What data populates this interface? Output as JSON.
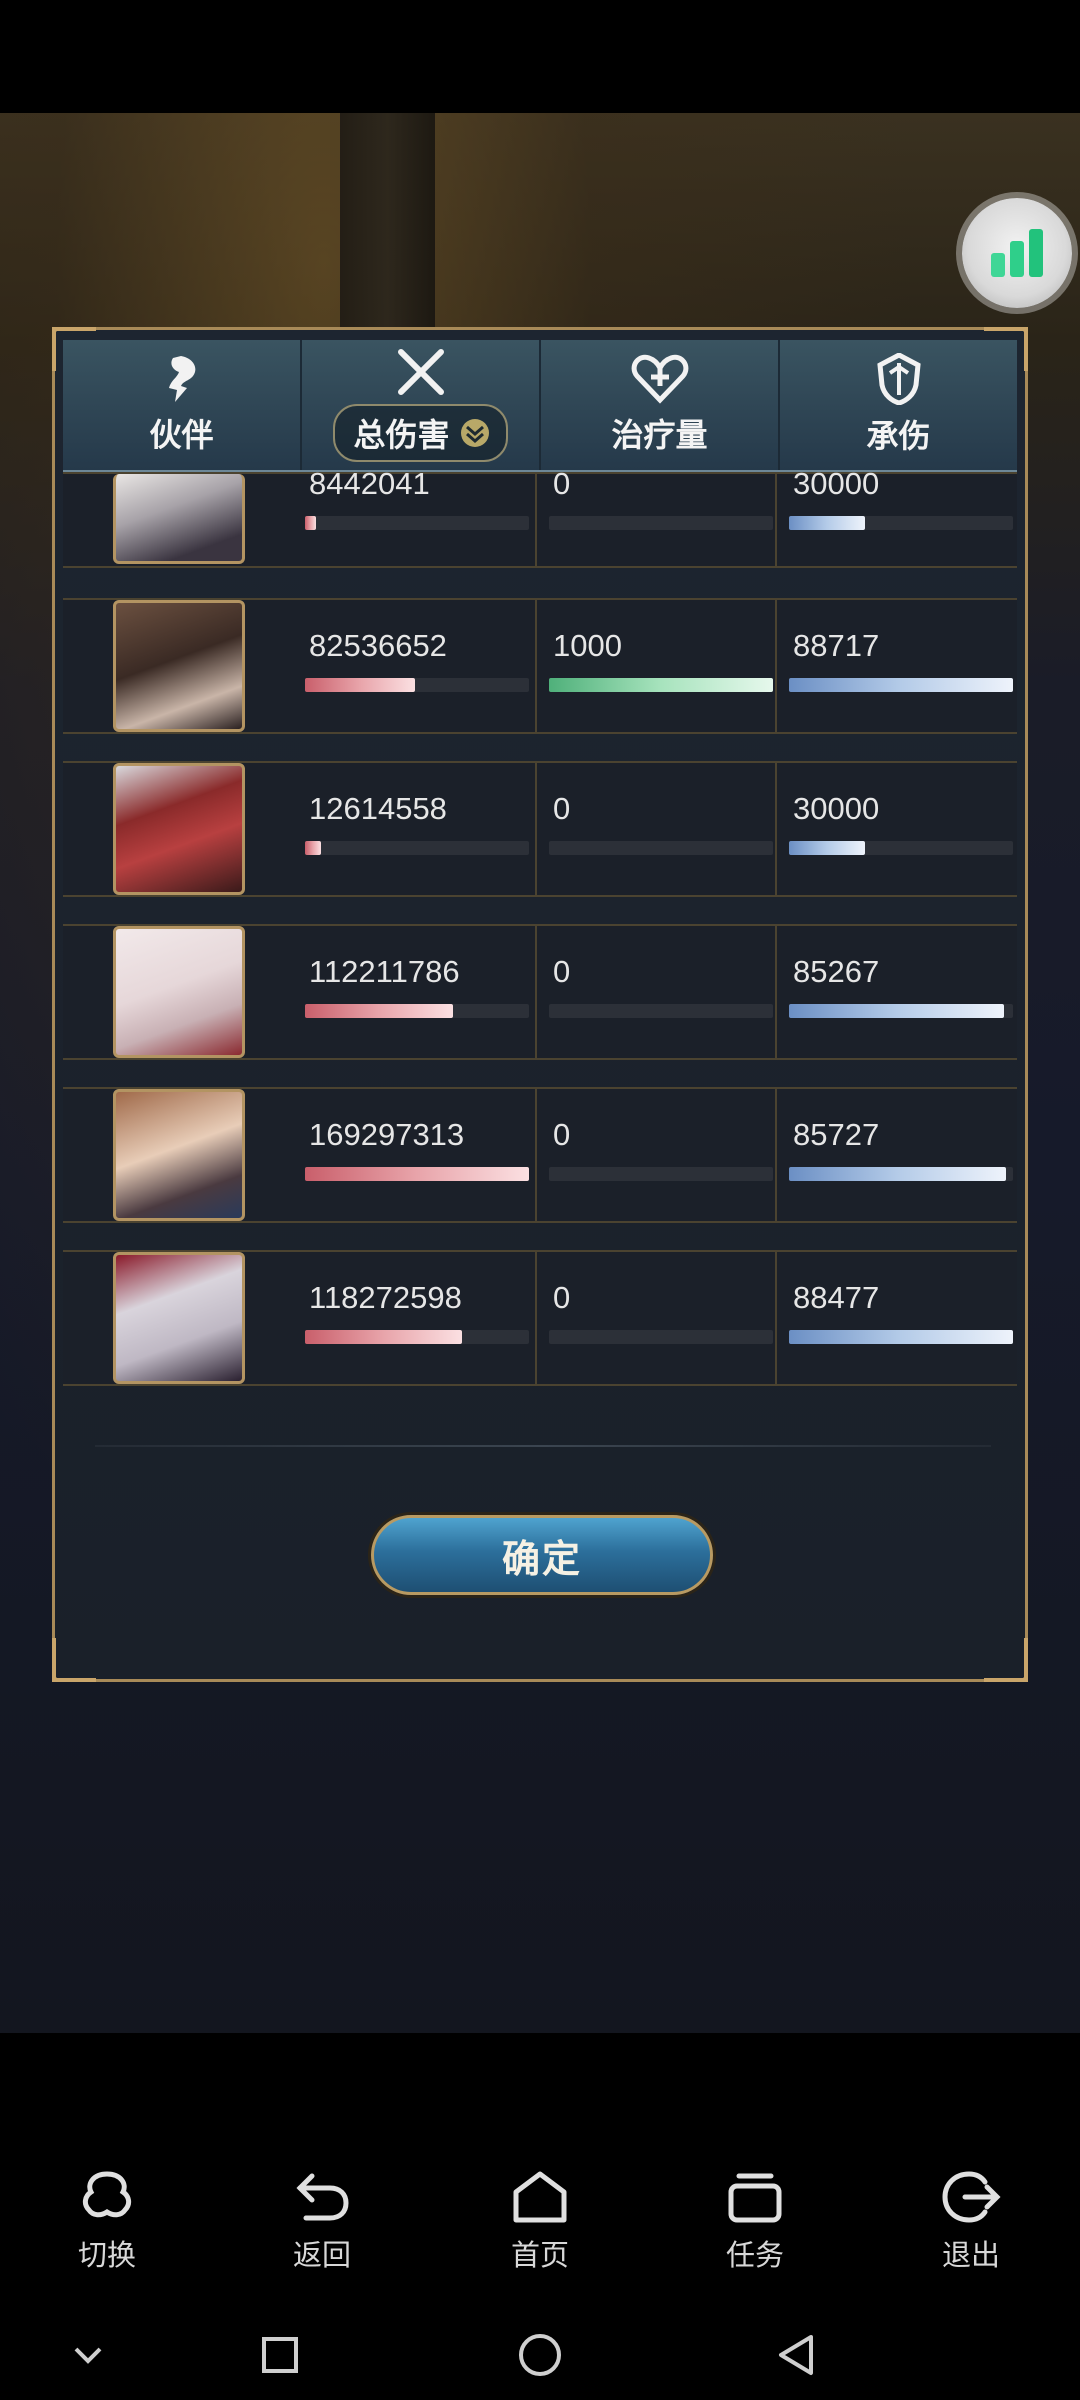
{
  "tabs": {
    "partner": "伙伴",
    "total_damage": "总伤害",
    "healing": "治疗量",
    "damage_taken": "承伤"
  },
  "rows": [
    {
      "damage": "8442041",
      "damage_ratio": 0.05,
      "healing": "0",
      "healing_ratio": 0,
      "taken": "30000",
      "taken_ratio": 0.34
    },
    {
      "damage": "82536652",
      "damage_ratio": 0.49,
      "healing": "1000",
      "healing_ratio": 1.0,
      "taken": "88717",
      "taken_ratio": 1.0
    },
    {
      "damage": "12614558",
      "damage_ratio": 0.07,
      "healing": "0",
      "healing_ratio": 0,
      "taken": "30000",
      "taken_ratio": 0.34
    },
    {
      "damage": "112211786",
      "damage_ratio": 0.66,
      "healing": "0",
      "healing_ratio": 0,
      "taken": "85267",
      "taken_ratio": 0.96
    },
    {
      "damage": "169297313",
      "damage_ratio": 1.0,
      "healing": "0",
      "healing_ratio": 0,
      "taken": "85727",
      "taken_ratio": 0.97
    },
    {
      "damage": "118272598",
      "damage_ratio": 0.7,
      "healing": "0",
      "healing_ratio": 0,
      "taken": "88477",
      "taken_ratio": 1.0
    }
  ],
  "confirm_label": "确定",
  "bottom_nav": {
    "switch": "切换",
    "back": "返回",
    "home": "首页",
    "tasks": "任务",
    "exit": "退出"
  },
  "colors": {
    "damage_bar": "#d9838c",
    "healing_bar": "#6cc795",
    "taken_bar": "#8fb0d9",
    "gold_border": "#a88a58",
    "stats_icon": "#2fcf8a"
  }
}
